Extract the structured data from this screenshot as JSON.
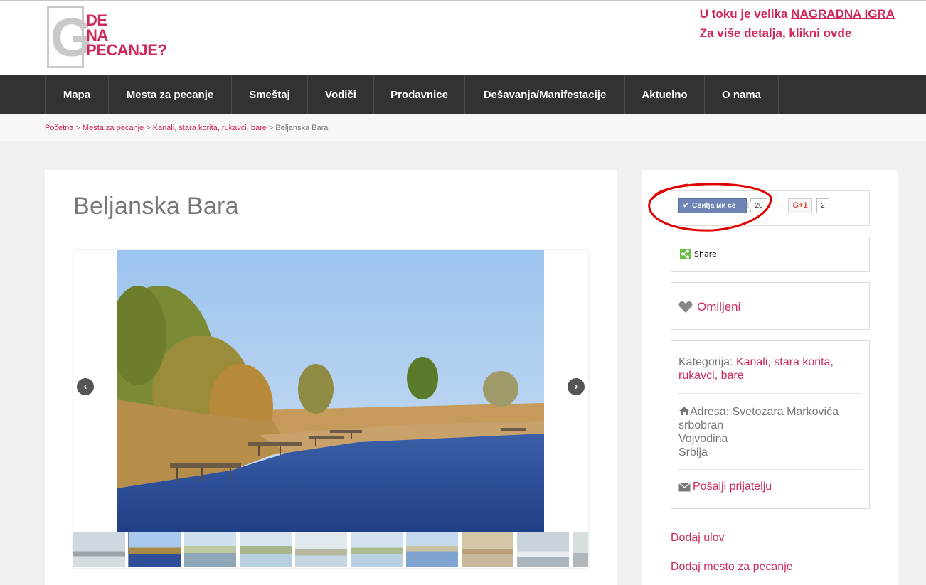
{
  "logo": {
    "letter": "G",
    "words": [
      "DE",
      "NA",
      "PECANJE?"
    ]
  },
  "promo": {
    "line1_text": "U toku je velika ",
    "line1_link": "NAGRADNA IGRA",
    "line2_text": "Za više detalja, klikni ",
    "line2_link": "ovde"
  },
  "nav": {
    "items": [
      {
        "label": "Mapa"
      },
      {
        "label": "Mesta za pecanje"
      },
      {
        "label": "Smeštaj"
      },
      {
        "label": "Vodiči"
      },
      {
        "label": "Prodavnice"
      },
      {
        "label": "Dešavanja/Manifestacije"
      },
      {
        "label": "Aktuelno"
      },
      {
        "label": "O nama"
      }
    ]
  },
  "breadcrumb": {
    "home": "Početna",
    "section": "Mesta za pecanje",
    "category": "Kanali, stara korita, rukavci, bare",
    "current": "Beljanska Bara",
    "separator": " > "
  },
  "page": {
    "title": "Beljanska Bara"
  },
  "gallery": {
    "prev_icon": "‹",
    "next_icon": "›",
    "thumb_count": 10
  },
  "social": {
    "like_label": "Свиђа ми се",
    "like_count": "20",
    "gplus_label": "G+1",
    "gplus_count": "2",
    "share_label": "Share"
  },
  "favorite": {
    "label": "Omiljeni"
  },
  "info": {
    "category_label": "Kategorija: ",
    "category_value": "Kanali, stara korita, rukavci, bare",
    "address_label": "Adresa: ",
    "address_street": "Svetozara Markovića",
    "address_city": "srbobran",
    "address_region": "Vojvodina",
    "address_country": "Srbija",
    "send_label": "Pošalji prijatelju"
  },
  "links": {
    "add_catch": "Dodaj ulov",
    "add_spot": "Dodaj mesto za pecanje"
  },
  "colors": {
    "accent": "#d0285a",
    "nav_bg": "#323232",
    "page_bg": "#f0f0f0"
  }
}
